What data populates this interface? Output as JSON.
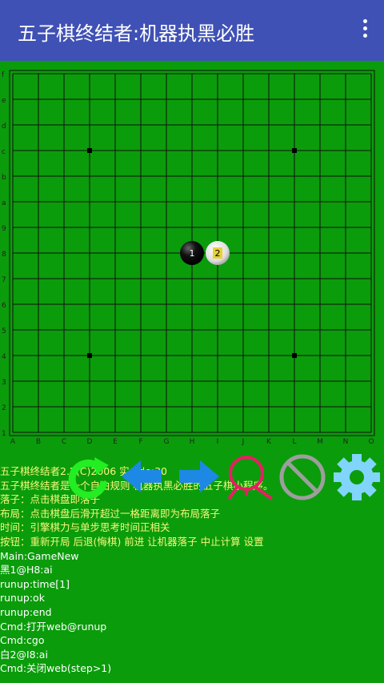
{
  "appbar": {
    "title": "五子棋终结者:机器执黑必胜",
    "menu_icon": "more-vert-icon"
  },
  "board": {
    "rows": [
      "1",
      "2",
      "3",
      "4",
      "5",
      "6",
      "7",
      "8",
      "9",
      "a",
      "b",
      "c",
      "d",
      "e",
      "f"
    ],
    "cols": [
      "A",
      "B",
      "C",
      "D",
      "E",
      "F",
      "G",
      "H",
      "I",
      "J",
      "K",
      "L",
      "M",
      "N",
      "O"
    ],
    "star_points": [
      "D4",
      "L4",
      "D12",
      "L12"
    ],
    "stones": [
      {
        "pos": "H8",
        "color": "black",
        "label": "1"
      },
      {
        "pos": "I8",
        "color": "white",
        "label": "2"
      }
    ]
  },
  "toolbar": [
    {
      "name": "new-game-button",
      "icon": "refresh-icon",
      "color": "#22ee22"
    },
    {
      "name": "undo-button",
      "icon": "arrow-left-icon",
      "color": "#1e88e5"
    },
    {
      "name": "forward-button",
      "icon": "arrow-right-icon",
      "color": "#1e88e5"
    },
    {
      "name": "ai-move-button",
      "icon": "search-person-icon",
      "color": "#e91e63"
    },
    {
      "name": "stop-button",
      "icon": "stop-circle-icon",
      "color": "#9e9e9e"
    },
    {
      "name": "settings-button",
      "icon": "gear-icon",
      "color": "#81d4fa"
    }
  ],
  "log": [
    {
      "text": "五子棋终结者2.2(C)2006 实   ode:30",
      "style": "yellow"
    },
    {
      "text": "五子棋终结者是一个自由规则 机器执黑必胜的五子棋小程序。",
      "style": "yellow"
    },
    {
      "text": "落子：点击棋盘即落子",
      "style": "yellow"
    },
    {
      "text": "布局：点击棋盘后滑开超过一格距离即为布局落子",
      "style": "yellow"
    },
    {
      "text": "时间：引擎棋力与单步思考时间正相关",
      "style": "yellow"
    },
    {
      "text": "按钮：重新开局  后退(悔棋)  前进  让机器落子  中止计算  设置",
      "style": "yellow"
    },
    {
      "text": "Main:GameNew",
      "style": "white"
    },
    {
      "text": "黑1@H8:ai",
      "style": "white"
    },
    {
      "text": "runup:time[1]",
      "style": "white"
    },
    {
      "text": "runup:ok",
      "style": "white"
    },
    {
      "text": "runup:end",
      "style": "white"
    },
    {
      "text": "Cmd:打开web@runup",
      "style": "white"
    },
    {
      "text": "Cmd:cgo",
      "style": "white"
    },
    {
      "text": "白2@I8:ai",
      "style": "white"
    },
    {
      "text": "Cmd:关闭web(step>1)",
      "style": "white"
    }
  ]
}
